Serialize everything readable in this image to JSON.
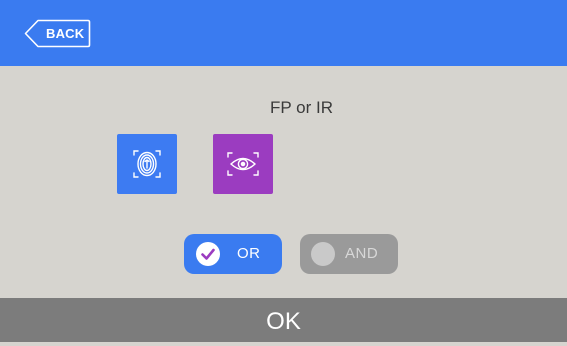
{
  "header": {
    "back_label": "BACK",
    "back_icon": "chevron-left-icon"
  },
  "main": {
    "mode_title": "FP or IR",
    "methods": [
      {
        "name": "fingerprint",
        "icon": "fingerprint-icon"
      },
      {
        "name": "iris",
        "icon": "eye-icon"
      }
    ],
    "logic_options": [
      {
        "label": "OR",
        "selected": true
      },
      {
        "label": "AND",
        "selected": false
      }
    ]
  },
  "footer": {
    "ok_label": "OK"
  },
  "colors": {
    "header_blue": "#3a7bf0",
    "background": "#d6d4cf",
    "fingerprint_tile": "#3d7bf2",
    "iris_tile": "#9b3cc0",
    "unselected_toggle": "#9a9a9a",
    "footer": "#7c7c7c"
  }
}
